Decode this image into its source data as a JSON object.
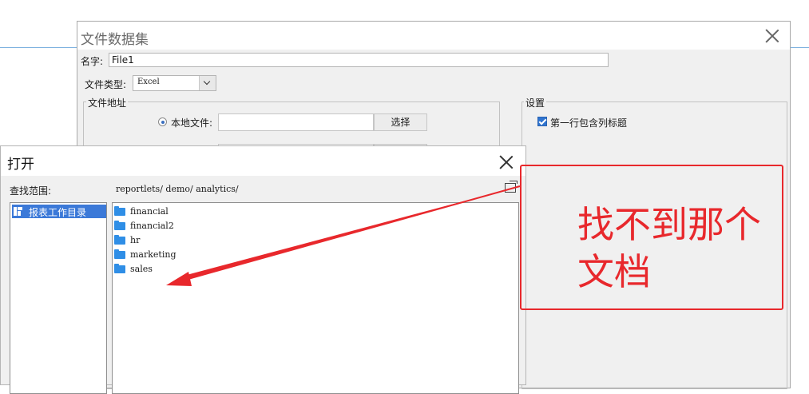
{
  "dataset_dialog": {
    "title": "文件数据集",
    "name_label": "名字:",
    "name_value": "File1",
    "file_type_label": "文件类型:",
    "file_type_value": "Excel",
    "file_address_group": "文件地址",
    "local_file_label": "本地文件:",
    "choose_button": "选择",
    "settings_group": "设置",
    "first_row_header_label": "第一行包含列标题",
    "first_row_header_checked": true
  },
  "open_dialog": {
    "title": "打开",
    "scope_label": "查找范围:",
    "path": "reportlets/ demo/ analytics/",
    "tree_items": [
      {
        "label": "报表工作目录",
        "icon": "report-directory-icon",
        "selected": true
      }
    ],
    "folders": [
      {
        "name": "financial"
      },
      {
        "name": "financial2"
      },
      {
        "name": "hr"
      },
      {
        "name": "marketing"
      },
      {
        "name": "sales"
      }
    ]
  },
  "annotation": {
    "text": "找不到那个文档",
    "color": "#e8282c"
  },
  "colors": {
    "selection": "#3b79d8",
    "folder": "#2f8ee6",
    "checkbox": "#2f74d0"
  }
}
